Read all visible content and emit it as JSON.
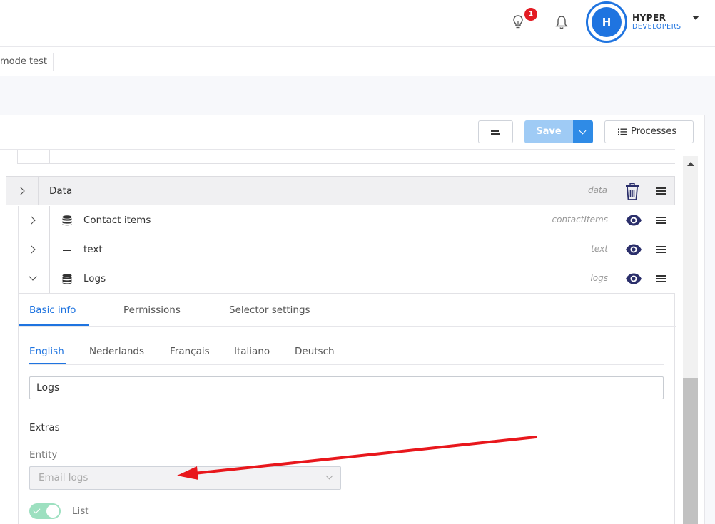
{
  "header": {
    "notification_count": "1",
    "user": {
      "initial": "H",
      "name": "HYPER",
      "org": "DEVELOPERS"
    }
  },
  "breadcrumb": {
    "current": "mode test"
  },
  "toolbar": {
    "save_label": "Save",
    "processes_label": "Processes"
  },
  "rows": [
    {
      "label": "Data",
      "key": "data",
      "icon": "none",
      "action_icon": "trash-icon"
    },
    {
      "label": "Contact items",
      "key": "contactItems",
      "icon": "database-icon",
      "action_icon": "eye-icon"
    },
    {
      "label": "text",
      "key": "text",
      "icon": "dash-icon",
      "action_icon": "eye-icon"
    },
    {
      "label": "Logs",
      "key": "logs",
      "icon": "database-icon",
      "action_icon": "eye-icon"
    }
  ],
  "detail": {
    "tabs": [
      "Basic info",
      "Permissions",
      "Selector settings"
    ],
    "active_tab": "Basic info",
    "languages": [
      "English",
      "Nederlands",
      "Français",
      "Italiano",
      "Deutsch"
    ],
    "active_language": "English",
    "name_value": "Logs",
    "extras_title": "Extras",
    "entity_label": "Entity",
    "entity_value": "Email logs",
    "list_label": "List",
    "list_enabled": true
  },
  "colors": {
    "accent": "#1f74e0",
    "save_disabled": "#9fcbf5",
    "badge": "#e31b23",
    "toggle_on": "#9de0c0",
    "annotation_arrow": "#e8171c",
    "eye": "#2b2f6b"
  }
}
